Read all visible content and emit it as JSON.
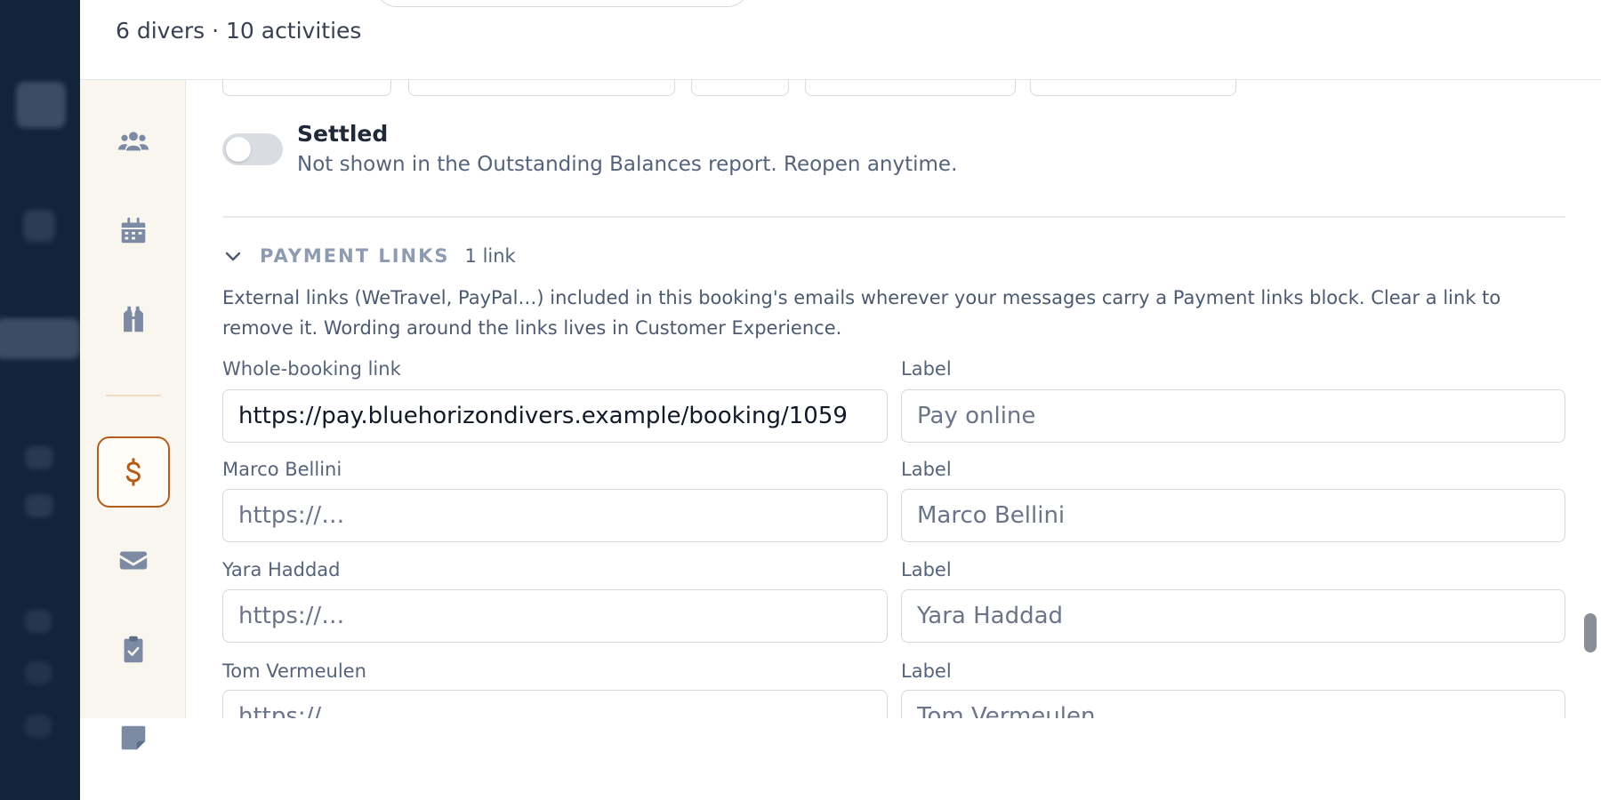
{
  "header": {
    "subtitle": "6 divers · 10 activities"
  },
  "rail": {
    "items": [
      {
        "icon": "users-icon"
      },
      {
        "icon": "calendar-icon"
      },
      {
        "icon": "dive-gear-icon"
      },
      {
        "icon": "dollar-icon",
        "active": true
      },
      {
        "icon": "envelope-icon"
      },
      {
        "icon": "clipboard-check-icon"
      },
      {
        "icon": "sticky-note-icon"
      }
    ]
  },
  "settled": {
    "title": "Settled",
    "description": "Not shown in the Outstanding Balances report. Reopen anytime.",
    "on": false
  },
  "payment_links": {
    "title": "PAYMENT LINKS",
    "count": "1 link",
    "help": "External links (WeTravel, PayPal…) included in this booking's emails wherever your messages carry a Payment links block. Clear a link to remove it. Wording around the links lives in Customer Experience.",
    "rows": [
      {
        "label": "Whole-booking link",
        "url_value": "https://pay.bluehorizondivers.example/booking/1059",
        "url_placeholder": "https://…",
        "label_title": "Label",
        "label_value": "",
        "label_placeholder": "Pay online"
      },
      {
        "label": "Marco Bellini",
        "url_value": "",
        "url_placeholder": "https://…",
        "label_title": "Label",
        "label_value": "",
        "label_placeholder": "Marco Bellini"
      },
      {
        "label": "Yara Haddad",
        "url_value": "",
        "url_placeholder": "https://…",
        "label_title": "Label",
        "label_value": "",
        "label_placeholder": "Yara Haddad"
      },
      {
        "label": "Tom Vermeulen",
        "url_value": "",
        "url_placeholder": "https://…",
        "label_title": "Label",
        "label_value": "",
        "label_placeholder": "Tom Vermeulen"
      }
    ]
  },
  "colors": {
    "accent": "#b45d1a",
    "rail_bg": "#f9f5ef",
    "icon": "#7c8aa3",
    "backdrop": "#13233a"
  }
}
